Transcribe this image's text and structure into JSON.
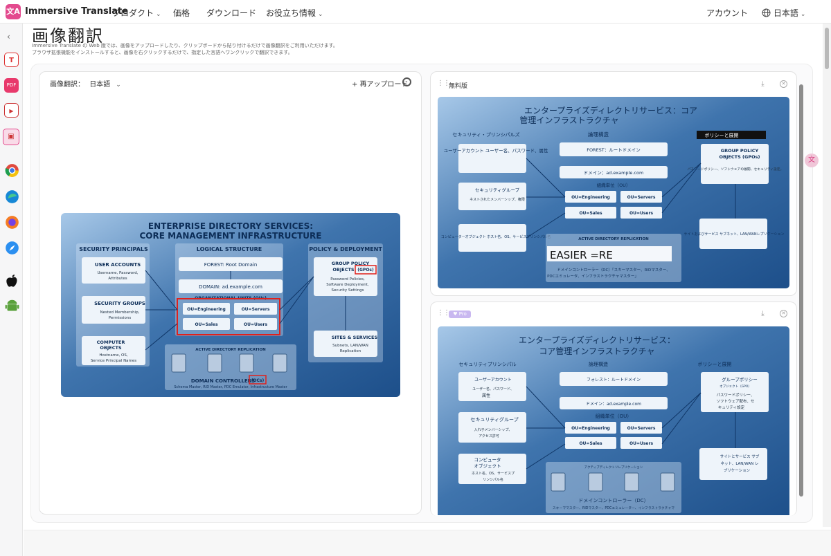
{
  "brand": {
    "name": "Immersive Translate",
    "logo_glyph": "文A",
    "accent": "#e34a8e"
  },
  "nav": {
    "items": [
      {
        "label": "プロダクト",
        "dropdown": true
      },
      {
        "label": "価格",
        "dropdown": false
      },
      {
        "label": "ダウンロード",
        "dropdown": false
      },
      {
        "label": "お役立ち情報",
        "dropdown": true
      }
    ]
  },
  "header_right": {
    "account": "アカウント",
    "language": "日本語",
    "globe_icon": "globe-icon"
  },
  "sidebar": {
    "collapse_glyph": "‹",
    "items": [
      {
        "name": "text-translate-icon",
        "glyph": "T"
      },
      {
        "name": "pdf-translate-icon",
        "glyph": "PDF"
      },
      {
        "name": "video-translate-icon",
        "glyph": "▶"
      },
      {
        "name": "image-translate-icon",
        "glyph": "▣"
      },
      {
        "name": "chrome-icon",
        "glyph": ""
      },
      {
        "name": "edge-icon",
        "glyph": ""
      },
      {
        "name": "firefox-icon",
        "glyph": ""
      },
      {
        "name": "safari-icon",
        "glyph": ""
      },
      {
        "name": "apple-icon",
        "glyph": ""
      },
      {
        "name": "android-icon",
        "glyph": ""
      }
    ]
  },
  "page": {
    "title": "画像翻訳",
    "desc1": "Immersive Translate の Web 版では、画像をアップロードしたり、クリップボードから貼り付けるだけで画像翻訳をご利用いただけます。",
    "desc2": "ブラウザ拡張機能をインストールすると、画像を右クリックするだけで、指定した言語へワンクリックで翻訳できます。"
  },
  "source_panel": {
    "label": "画像翻訳：",
    "language": "日本語",
    "reupload": "+ 再アップロード"
  },
  "source_image": {
    "title1": "ENTERPRISE DIRECTORY SERVICES:",
    "title2": "CORE MANAGEMENT INFRASTRUCTURE",
    "col_security": "SECURITY PRINCIPALS",
    "col_logical": "LOGICAL STRUCTURE",
    "col_policy": "POLICY & DEPLOYMENT",
    "user_accounts": "USER ACCOUNTS",
    "user_accounts_sub1": "Username, Password,",
    "user_accounts_sub2": "Attributes",
    "security_groups": "SECURITY GROUPS",
    "security_groups_sub1": "Nested Membership,",
    "security_groups_sub2": "Permissions",
    "computer_objects1": "COMPUTER",
    "computer_objects2": "OBJECTS",
    "computer_sub1": "Hostname, OS,",
    "computer_sub2": "Service Principal Names",
    "forest": "FOREST: Root Domain",
    "domain": "DOMAIN: ad.example.com",
    "ou_header": "ORGANIZATIONAL UNITS (OUs)",
    "ou_engineering": "OU=Engineering",
    "ou_servers": "OU=Servers",
    "ou_sales": "OU=Sales",
    "ou_users": "OU=Users",
    "replication": "ACTIVE DIRECTORY REPLICATION",
    "dc_title": "DOMAIN CONTROLLERS",
    "dc_tag": "(DCs)",
    "dc_sub": "Schema Master, RID Master, PDC Emulator, Infrastructure Master",
    "gpo1": "GROUP POLICY",
    "gpo2": "OBJECTS",
    "gpo_tag": "(GPOs)",
    "gpo_sub1": "Password Policies,",
    "gpo_sub2": "Software Deployment,",
    "gpo_sub3": "Security Settings",
    "sites": "SITES & SERVICES",
    "sites_sub1": "Subnets, LAN/WAN",
    "sites_sub2": "Replication"
  },
  "free_card": {
    "title": "無料版",
    "img": {
      "title1": "エンタープライズディレクトリサービス：コア",
      "title2": "管理インフラストラクチャ",
      "col_security": "セキュリティ・プリンシパルズ",
      "col_logical": "論理構造",
      "col_policy": "ポリシーと展開",
      "user_accounts": "ユーザーアカウント ユーザー名、パスワード、属性",
      "security_groups": "セキュリティグループ",
      "security_groups_sub": "ネストされたメンバーシップ、権限",
      "computer": "コンピューターオブジェクト ホスト名、OS、サービスプリンシパル名",
      "forest": "FOREST：ルートドメイン",
      "domain": "ドメイン：ad.example.com",
      "ou_header": "組織単位（OU）",
      "ou_engineering": "OU=Engineering",
      "ou_servers": "OU=Servers",
      "ou_sales": "OU=Sales",
      "ou_users": "OU=Users",
      "replication": "ACTIVE DIRECTORY REPLICATION",
      "easier": "EASIER =RE",
      "dc_sub1": "ドメインコントローラー（DC）「スキーマスター、RIDマスター、",
      "dc_sub2": "PDCエミュレータ、インフラストラクチャマスター」",
      "gpo1": "GROUP POLICY",
      "gpo2": "OBJECTS (GPOs)",
      "gpo_sub": "パスワードポリシー、ソフトウェアの展開、セキュリティ設定。",
      "sites": "サイトおよびサービス サブネット、LAN/WANレプリケーション"
    }
  },
  "pro_card": {
    "badge": "Pro",
    "img": {
      "title1": "エンタープライズディレクトリサービス：",
      "title2": "コア管理インフラストラクチャ",
      "col_security": "セキュリティプリンシパル",
      "col_logical": "論理構造",
      "col_policy": "ポリシーと展開",
      "user_accounts": "ユーザーアカウント",
      "user_sub1": "ユーザー名、パスワード、",
      "user_sub2": "属性",
      "security_groups": "セキュリティグループ",
      "security_groups_sub1": "入れ子メンバーシップ、",
      "security_groups_sub2": "アクセス許可",
      "computer1": "コンピュータ",
      "computer2": "オブジェクト",
      "computer_sub1": "ホスト名、OS、サービスプ",
      "computer_sub2": "リンシパル名",
      "forest": "フォレスト：ルートドメイン",
      "domain": "ドメイン：ad.example.com",
      "ou_header": "組織単位（OU）",
      "ou_engineering": "OU=Engineering",
      "ou_servers": "OU=Servers",
      "ou_sales": "OU=Sales",
      "ou_users": "OU=Users",
      "replication": "アクティブディレクトリレプリケーション",
      "dc_title": "ドメインコントローラー（DC）",
      "dc_sub": "スキーママスター、RIDマスター、PDCエミュレーター、インフラストラクチャマ",
      "gpo1": "グループポリシー",
      "gpo2": "オブジェクト（GPO）",
      "gpo_sub1": "パスワードポリシー、",
      "gpo_sub2": "ソフトウェア配布、セ",
      "gpo_sub3": "キュリティ設定",
      "sites1": "サイトとサービス サブ",
      "sites2": "ネット、LAN/WAN レ",
      "sites3": "プリケーション"
    }
  },
  "icons": {
    "download": "download-icon",
    "close": "close-icon",
    "settings": "settings-icon",
    "drag": "drag-handle-icon"
  },
  "colors": {
    "diagram_bg": "#2b5f98",
    "highlight": "#e0201b"
  }
}
